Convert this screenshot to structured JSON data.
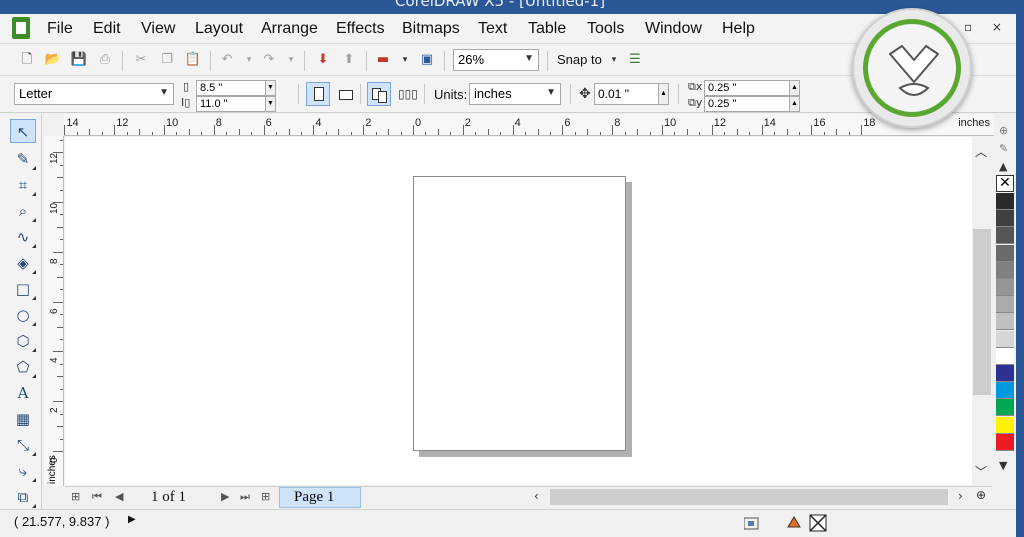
{
  "window": {
    "title": "CorelDRAW X5 - [Untitled-1]",
    "controls": [
      "–",
      "□",
      "×"
    ]
  },
  "menu": {
    "items": [
      "File",
      "Edit",
      "View",
      "Layout",
      "Arrange",
      "Effects",
      "Bitmaps",
      "Text",
      "Table",
      "Tools",
      "Window",
      "Help"
    ],
    "mdi_controls": "▫ ×"
  },
  "toolbar": {
    "zoom_value": "26%",
    "snap_label": "Snap to"
  },
  "property_bar": {
    "paper_size": "Letter",
    "width": "8.5 \"",
    "height": "11.0 \"",
    "units_label": "Units:",
    "units_value": "inches",
    "nudge": "0.01 \"",
    "dup_x": "0.25 \"",
    "dup_y": "0.25 \""
  },
  "ruler": {
    "h_labels": [
      "14",
      "12",
      "10",
      "8",
      "6",
      "4",
      "2",
      "0",
      "2",
      "4",
      "6",
      "8",
      "10",
      "12",
      "14",
      "16",
      "18"
    ],
    "v_labels": [
      "12",
      "10",
      "8",
      "6",
      "4",
      "2",
      "0"
    ],
    "unit_label": "inches"
  },
  "navigation": {
    "page_counter": "1 of 1",
    "page_tab": "Page 1"
  },
  "palette": {
    "colors": [
      "#2b2b2b",
      "#404040",
      "#555555",
      "#6a6a6a",
      "#808080",
      "#959595",
      "#aaaaaa",
      "#c0c0c0",
      "#d6d6d6",
      "#ffffff",
      "#2e3192",
      "#0099dd",
      "#00a651",
      "#fff200",
      "#ed1c24"
    ]
  },
  "status": {
    "coordinates": "( 21.577, 9.837  )"
  }
}
